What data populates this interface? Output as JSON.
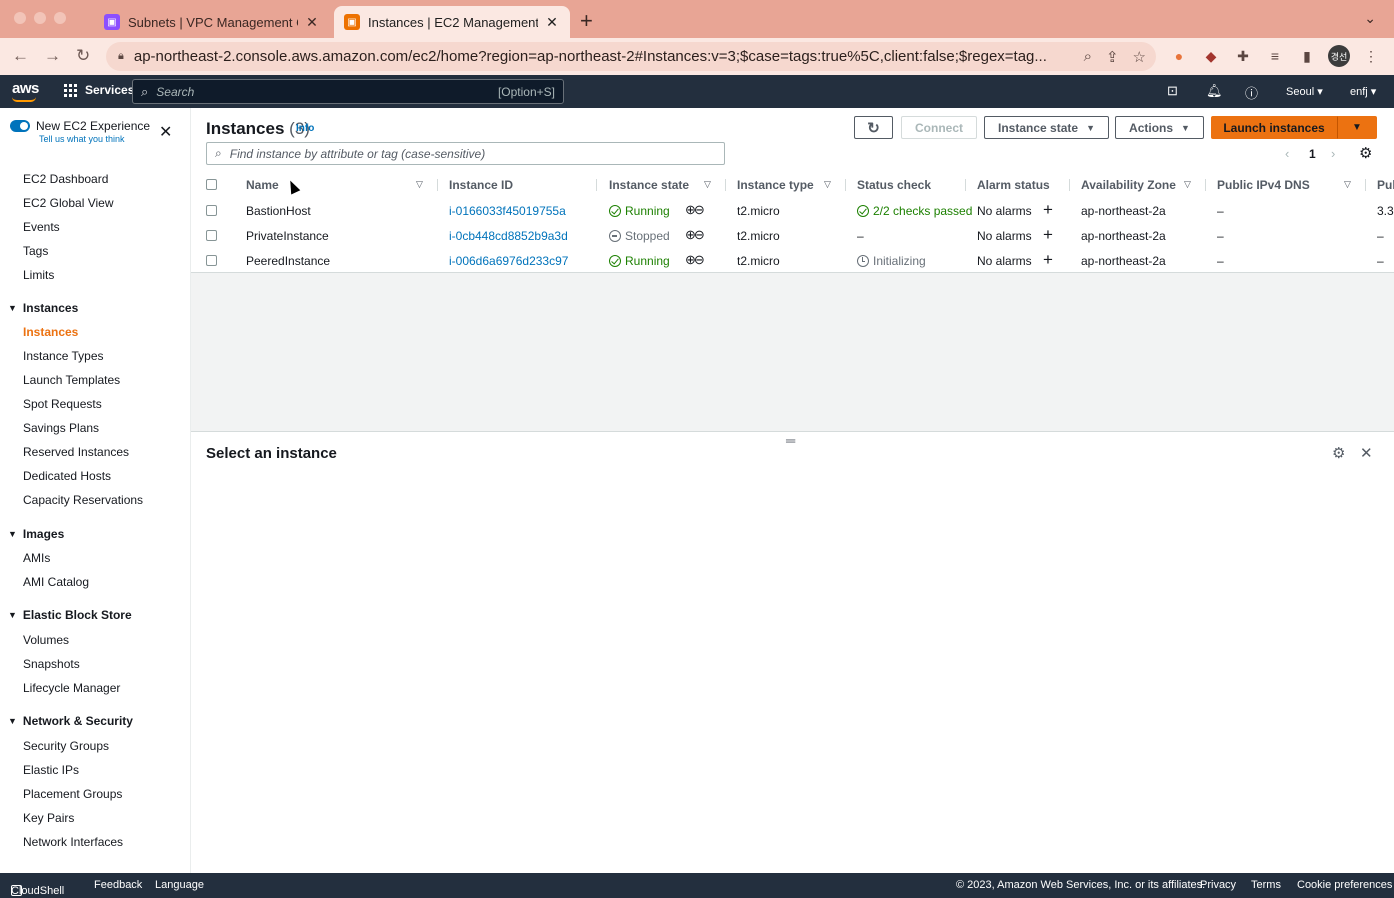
{
  "browser": {
    "tabs": [
      {
        "title": "Subnets | VPC Management Co",
        "favicon": "vpc-icon",
        "color": "#8c4fff"
      },
      {
        "title": "Instances | EC2 Management C",
        "favicon": "ec2-icon",
        "color": "#ed7100"
      }
    ],
    "url": "ap-northeast-2.console.aws.amazon.com/ec2/home?region=ap-northeast-2#Instances:v=3;$case=tags:true%5C,client:false;$regex=tag...",
    "profile_initials": "경선"
  },
  "aws_nav": {
    "logo": "aws",
    "services_label": "Services",
    "search_placeholder": "Search",
    "search_shortcut": "[Option+S]",
    "region": "Seoul",
    "account": "enfj"
  },
  "sidebar": {
    "new_experience_label": "New EC2 Experience",
    "feedback_link": "Tell us what you think",
    "top_items": [
      "EC2 Dashboard",
      "EC2 Global View",
      "Events",
      "Tags",
      "Limits"
    ],
    "sections": [
      {
        "title": "Instances",
        "items": [
          "Instances",
          "Instance Types",
          "Launch Templates",
          "Spot Requests",
          "Savings Plans",
          "Reserved Instances",
          "Dedicated Hosts",
          "Capacity Reservations"
        ]
      },
      {
        "title": "Images",
        "items": [
          "AMIs",
          "AMI Catalog"
        ]
      },
      {
        "title": "Elastic Block Store",
        "items": [
          "Volumes",
          "Snapshots",
          "Lifecycle Manager"
        ]
      },
      {
        "title": "Network & Security",
        "items": [
          "Security Groups",
          "Elastic IPs",
          "Placement Groups",
          "Key Pairs",
          "Network Interfaces"
        ]
      }
    ]
  },
  "main": {
    "title": "Instances",
    "count": "(3)",
    "info": "Info",
    "buttons": {
      "connect": "Connect",
      "instance_state": "Instance state",
      "actions": "Actions",
      "launch": "Launch instances"
    },
    "filter_placeholder": "Find instance by attribute or tag (case-sensitive)",
    "page": "1",
    "columns": [
      "Name",
      "Instance ID",
      "Instance state",
      "Instance type",
      "Status check",
      "Alarm status",
      "Availability Zone",
      "Public IPv4 DNS",
      "Pul"
    ],
    "rows": [
      {
        "name": "BastionHost",
        "id": "i-0166033f45019755a",
        "state": "Running",
        "type": "t2.micro",
        "status": "2/2 checks passed",
        "alarm": "No alarms",
        "az": "ap-northeast-2a",
        "dns": "–",
        "ip": "3.3"
      },
      {
        "name": "PrivateInstance",
        "id": "i-0cb448cd8852b9a3d",
        "state": "Stopped",
        "type": "t2.micro",
        "status": "–",
        "alarm": "No alarms",
        "az": "ap-northeast-2a",
        "dns": "–",
        "ip": "–"
      },
      {
        "name": "PeeredInstance",
        "id": "i-006d6a6976d233c97",
        "state": "Running",
        "type": "t2.micro",
        "status": "Initializing",
        "alarm": "No alarms",
        "az": "ap-northeast-2a",
        "dns": "–",
        "ip": "–"
      }
    ],
    "detail_title": "Select an instance"
  },
  "footer": {
    "cloudshell": "CloudShell",
    "feedback": "Feedback",
    "language": "Language",
    "copyright": "© 2023, Amazon Web Services, Inc. or its affiliates.",
    "privacy": "Privacy",
    "terms": "Terms",
    "cookies": "Cookie preferences"
  }
}
